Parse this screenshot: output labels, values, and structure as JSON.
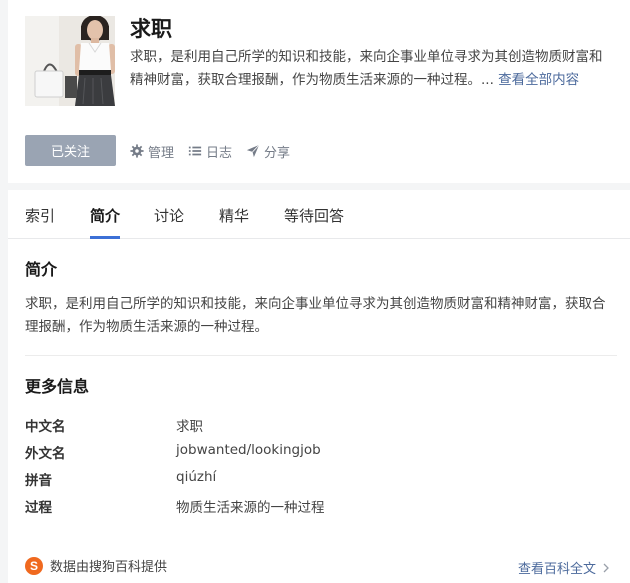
{
  "topic": {
    "title": "求职",
    "description": "求职，是利用自己所学的知识和技能，来向企事业单位寻求为其创造物质财富和精神财富，获取合理报酬，作为物质生活来源的一种过程。...",
    "more_link": "查看全部内容"
  },
  "actions": {
    "follow_label": "已关注",
    "manage_label": "管理",
    "manage_icon": "gear-icon",
    "log_label": "日志",
    "log_icon": "list-icon",
    "share_label": "分享",
    "share_icon": "send-icon"
  },
  "tabs": [
    {
      "label": "索引",
      "active": false
    },
    {
      "label": "简介",
      "active": true
    },
    {
      "label": "讨论",
      "active": false
    },
    {
      "label": "精华",
      "active": false
    },
    {
      "label": "等待回答",
      "active": false
    }
  ],
  "intro": {
    "heading": "简介",
    "text": "求职，是利用自己所学的知识和技能，来向企事业单位寻求为其创造物质财富和精神财富，获取合理报酬，作为物质生活来源的一种过程。"
  },
  "more_info": {
    "heading": "更多信息",
    "rows": [
      {
        "key": "中文名",
        "value": "求职"
      },
      {
        "key": "外文名",
        "value": "jobwanted/lookingjob"
      },
      {
        "key": "拼音",
        "value": "qiúzhí"
      },
      {
        "key": "过程",
        "value": "物质生活来源的一种过程"
      }
    ]
  },
  "footer": {
    "source_text": "数据由搜狗百科提供",
    "logo_letter": "S",
    "full_text_link": "查看百科全文"
  },
  "colors": {
    "accent": "#3c70d6",
    "link": "#4c6a9c",
    "follow_button": "#9aa4b3",
    "sogou_orange": "#f0691f"
  }
}
